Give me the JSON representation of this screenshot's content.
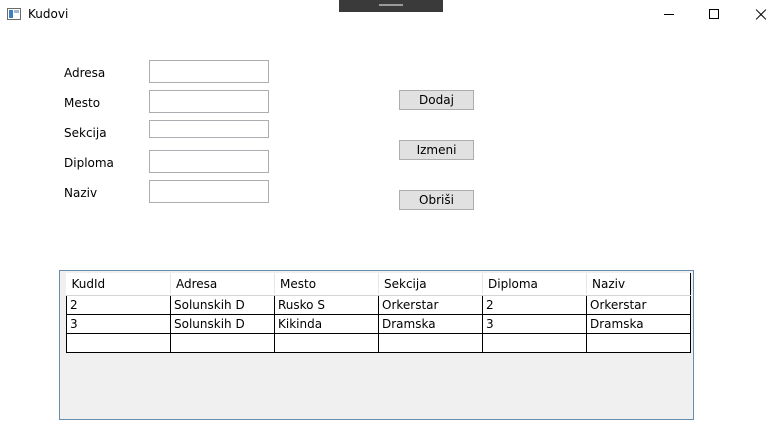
{
  "window": {
    "title": "Kudovi",
    "icons": {
      "app": "window-app-icon",
      "minimize": "minimize-icon",
      "maximize": "maximize-icon",
      "close": "close-icon"
    }
  },
  "form": {
    "fields": [
      {
        "label": "Adresa",
        "value": ""
      },
      {
        "label": "Mesto",
        "value": ""
      },
      {
        "label": "Sekcija",
        "value": ""
      },
      {
        "label": "Diploma",
        "value": ""
      },
      {
        "label": "Naziv",
        "value": ""
      }
    ]
  },
  "buttons": {
    "add": "Dodaj",
    "edit": "Izmeni",
    "delete": "Obriši"
  },
  "table": {
    "columns": [
      "KudId",
      "Adresa",
      "Mesto",
      "Sekcija",
      "Diploma",
      "Naziv"
    ],
    "rows": [
      [
        "2",
        "Solunskih D",
        "Rusko S",
        "Orkerstar",
        "2",
        "Orkerstar"
      ],
      [
        "3",
        "Solunskih D",
        "Kikinda",
        "Dramska",
        "3",
        "Dramska"
      ],
      [
        "",
        "",
        "",
        "",
        "",
        ""
      ]
    ]
  }
}
